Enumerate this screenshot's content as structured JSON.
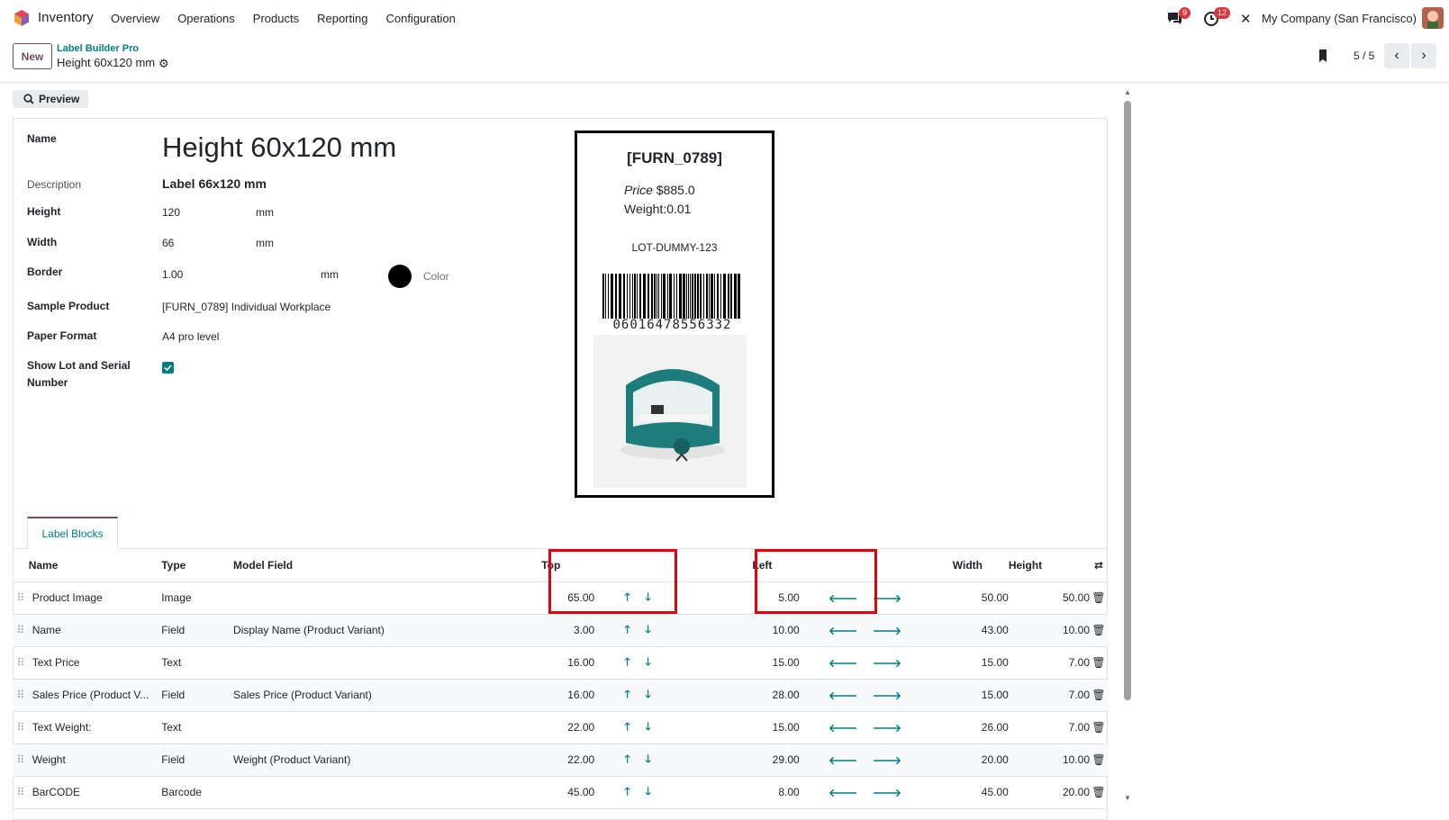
{
  "navbar": {
    "app_name": "Inventory",
    "menu": [
      "Overview",
      "Operations",
      "Products",
      "Reporting",
      "Configuration"
    ],
    "messages_badge": "9",
    "activities_badge": "12",
    "company": "My Company (San Francisco)"
  },
  "control_panel": {
    "new_label": "New",
    "breadcrumb_parent": "Label Builder Pro",
    "breadcrumb_current": "Height 60x120 mm",
    "pager": "5 / 5"
  },
  "preview_label": "Preview",
  "form": {
    "name_label": "Name",
    "name_value": "Height 60x120 mm",
    "description_label": "Description",
    "description_value": "Label 66x120 mm",
    "height_label": "Height",
    "height_value": "120",
    "width_label": "Width",
    "width_value": "66",
    "border_label": "Border",
    "border_value": "1.00",
    "unit": "mm",
    "color_label": "Color",
    "color_value": "#000000",
    "sample_product_label": "Sample Product",
    "sample_product_value": "[FURN_0789] Individual Workplace",
    "paper_format_label": "Paper Format",
    "paper_format_value": "A4 pro level",
    "lot_label_line1": "Show Lot and Serial",
    "lot_label_line2": "Number",
    "lot_checked": true
  },
  "label_preview": {
    "code": "[FURN_0789]",
    "price_prefix": "Price",
    "price_value": " $885.0",
    "weight": "Weight:0.01",
    "lot": "LOT-DUMMY-123",
    "barcode": "06016478556332"
  },
  "tab": "Label Blocks",
  "table": {
    "headers": {
      "name": "Name",
      "type": "Type",
      "field": "Model Field",
      "top": "Top",
      "left": "Left",
      "width": "Width",
      "height": "Height"
    },
    "rows": [
      {
        "name": "Product Image",
        "type": "Image",
        "field": "",
        "top": "65.00",
        "left": "5.00",
        "width": "50.00",
        "height": "50.00"
      },
      {
        "name": "Name",
        "type": "Field",
        "field": "Display Name (Product Variant)",
        "top": "3.00",
        "left": "10.00",
        "width": "43.00",
        "height": "10.00"
      },
      {
        "name": "Text Price",
        "type": "Text",
        "field": "",
        "top": "16.00",
        "left": "15.00",
        "width": "15.00",
        "height": "7.00"
      },
      {
        "name": "Sales Price (Product V...",
        "type": "Field",
        "field": "Sales Price (Product Variant)",
        "top": "16.00",
        "left": "28.00",
        "width": "15.00",
        "height": "7.00"
      },
      {
        "name": "Text Weight:",
        "type": "Text",
        "field": "",
        "top": "22.00",
        "left": "15.00",
        "width": "26.00",
        "height": "7.00"
      },
      {
        "name": "Weight",
        "type": "Field",
        "field": "Weight (Product Variant)",
        "top": "22.00",
        "left": "29.00",
        "width": "20.00",
        "height": "10.00"
      },
      {
        "name": "BarCODE",
        "type": "Barcode",
        "field": "",
        "top": "45.00",
        "left": "8.00",
        "width": "45.00",
        "height": "20.00"
      }
    ]
  }
}
